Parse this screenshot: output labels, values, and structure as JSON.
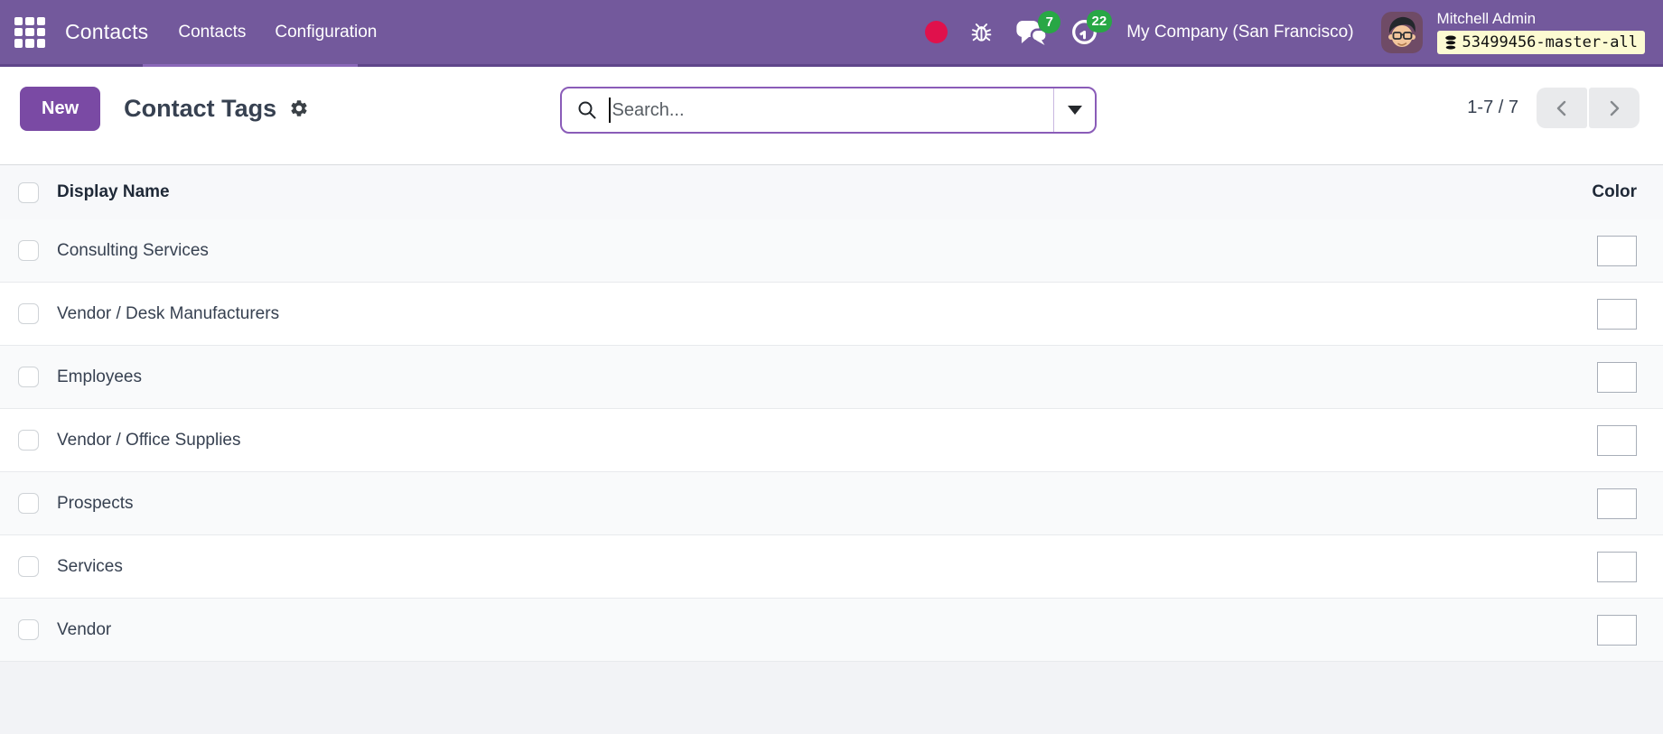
{
  "navbar": {
    "app_name": "Contacts",
    "menu_items": [
      {
        "label": "Contacts"
      },
      {
        "label": "Configuration"
      }
    ],
    "systray": {
      "messages_badge": "7",
      "activities_badge": "22",
      "company_name": "My Company (San Francisco)",
      "user_name": "Mitchell Admin",
      "database_badge": "53499456-master-all"
    }
  },
  "control_panel": {
    "new_button_label": "New",
    "breadcrumb_title": "Contact Tags",
    "search_placeholder": "Search...",
    "pager_text": "1-7 / 7"
  },
  "list": {
    "columns": {
      "name": "Display Name",
      "color": "Color"
    },
    "rows": [
      {
        "name": "Consulting Services",
        "color": "#DB8DC5"
      },
      {
        "name": "Vendor / Desk Manufacturers",
        "color": "#A2F2B5"
      },
      {
        "name": "Employees",
        "color": "#BDD3F6"
      },
      {
        "name": "Vendor / Office Supplies",
        "color": "#9E8DF2"
      },
      {
        "name": "Prospects",
        "color": "#F8EC85"
      },
      {
        "name": "Services",
        "color": "#70E7D2"
      },
      {
        "name": "Vendor",
        "color": "#F9C78F"
      }
    ]
  },
  "theme": {
    "navbar_color": "#73599C",
    "primary": "#7A4AA4",
    "badge_green": "#28A745",
    "dot_red": "#E0114C",
    "db_badge_bg": "#FCFAD2"
  }
}
